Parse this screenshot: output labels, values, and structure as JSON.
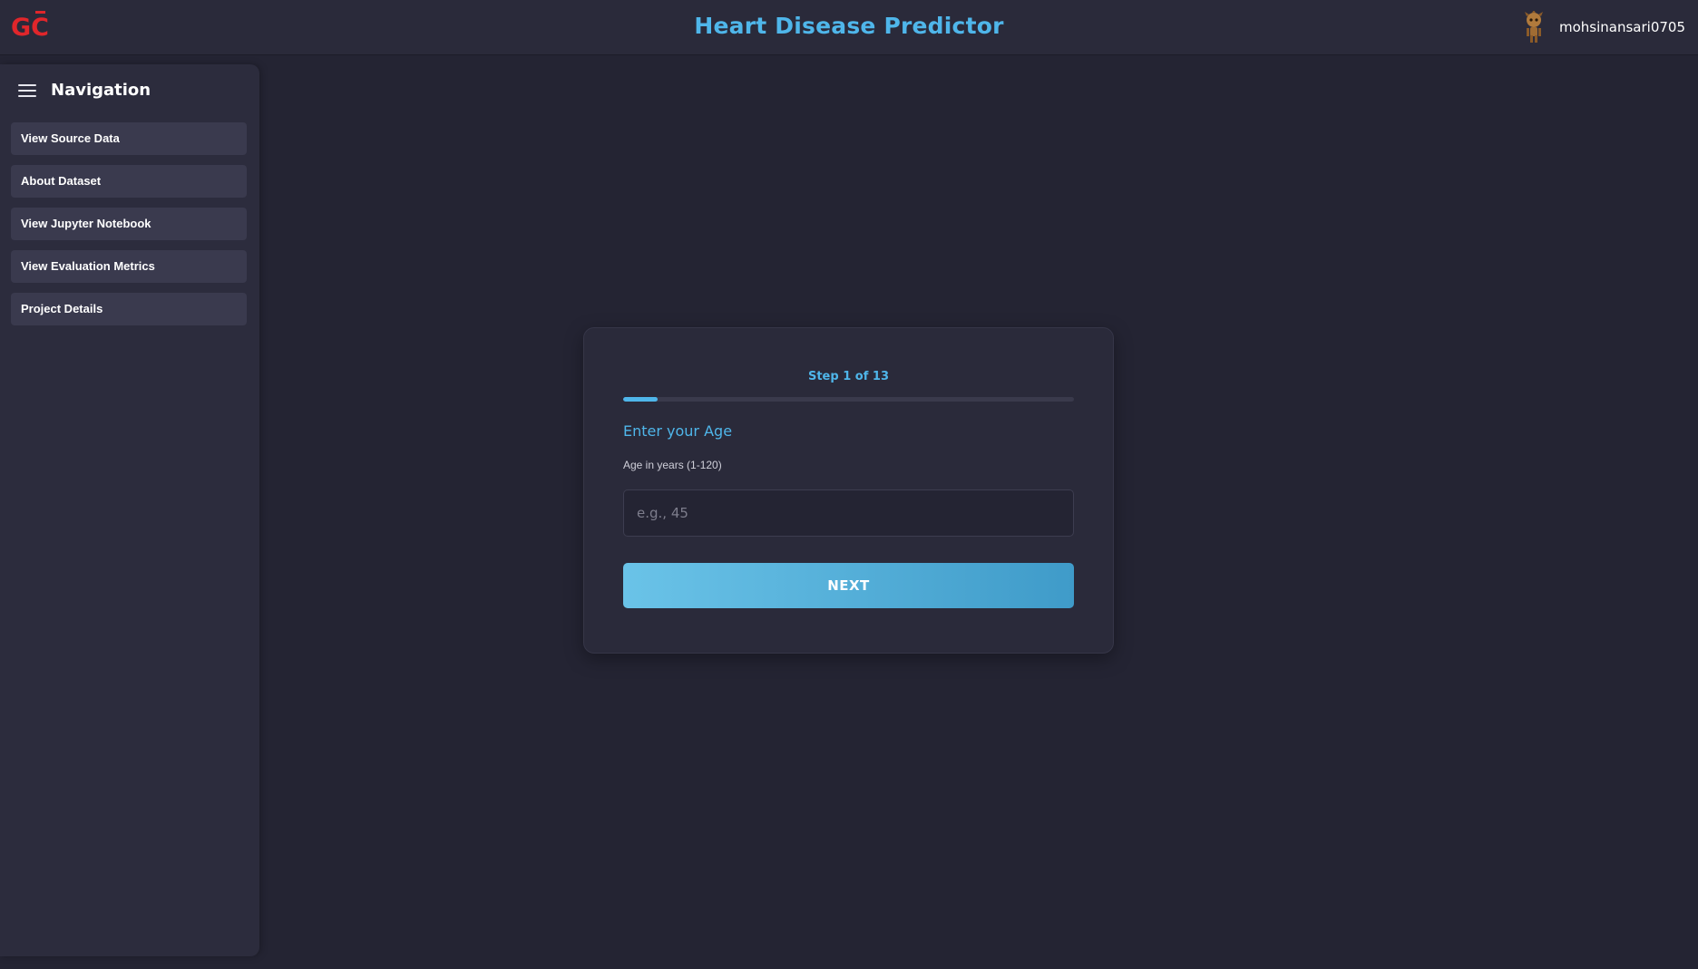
{
  "header": {
    "logo_text": "GC",
    "title": "Heart Disease Predictor",
    "username": "mohsinansari0705"
  },
  "sidebar": {
    "title": "Navigation",
    "items": [
      {
        "label": "View Source Data"
      },
      {
        "label": "About Dataset"
      },
      {
        "label": "View Jupyter Notebook"
      },
      {
        "label": "View Evaluation Metrics"
      },
      {
        "label": "Project Details"
      }
    ]
  },
  "form": {
    "step_label": "Step 1 of 13",
    "current_step": 1,
    "total_steps": 13,
    "question": "Enter your Age",
    "hint": "Age in years (1-120)",
    "input_placeholder": "e.g., 45",
    "input_value": "",
    "next_label": "NEXT"
  },
  "colors": {
    "accent": "#4fb6ea",
    "background": "#242433",
    "panel": "#2a2a3a",
    "logo_red": "#e0262b"
  }
}
